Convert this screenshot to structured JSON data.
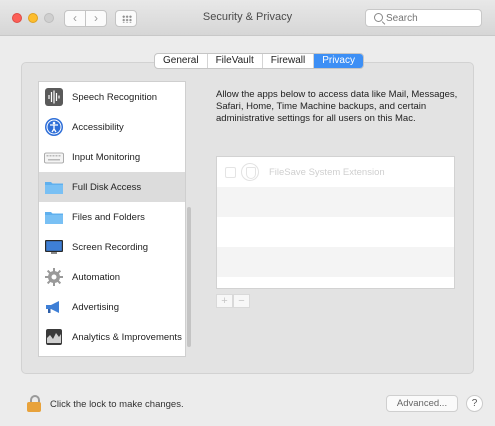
{
  "window": {
    "title": "Security & Privacy",
    "search_placeholder": "Search"
  },
  "tabs": [
    {
      "label": "General",
      "active": false
    },
    {
      "label": "FileVault",
      "active": false
    },
    {
      "label": "Firewall",
      "active": false
    },
    {
      "label": "Privacy",
      "active": true
    }
  ],
  "sidebar": {
    "items": [
      {
        "label": "Speech Recognition",
        "icon": "speech-waveform-icon",
        "selected": false
      },
      {
        "label": "Accessibility",
        "icon": "accessibility-icon",
        "selected": false
      },
      {
        "label": "Input Monitoring",
        "icon": "keyboard-icon",
        "selected": false
      },
      {
        "label": "Full Disk Access",
        "icon": "folder-icon",
        "selected": true
      },
      {
        "label": "Files and Folders",
        "icon": "folder-icon",
        "selected": false
      },
      {
        "label": "Screen Recording",
        "icon": "display-icon",
        "selected": false
      },
      {
        "label": "Automation",
        "icon": "gear-icon",
        "selected": false
      },
      {
        "label": "Advertising",
        "icon": "megaphone-icon",
        "selected": false
      },
      {
        "label": "Analytics & Improvements",
        "icon": "chart-icon",
        "selected": false
      }
    ]
  },
  "main": {
    "description": "Allow the apps below to access data like Mail, Messages, Safari, Home, Time Machine backups, and certain administrative settings for all users on this Mac.",
    "apps": [
      {
        "name": "FileSave System Extension",
        "checked": false
      }
    ],
    "add_label": "+",
    "remove_label": "−"
  },
  "footer": {
    "lock_text": "Click the lock to make changes.",
    "advanced_label": "Advanced...",
    "help_label": "?"
  },
  "colors": {
    "accent": "#3d8ff5",
    "lock_body": "#e8a23b"
  }
}
